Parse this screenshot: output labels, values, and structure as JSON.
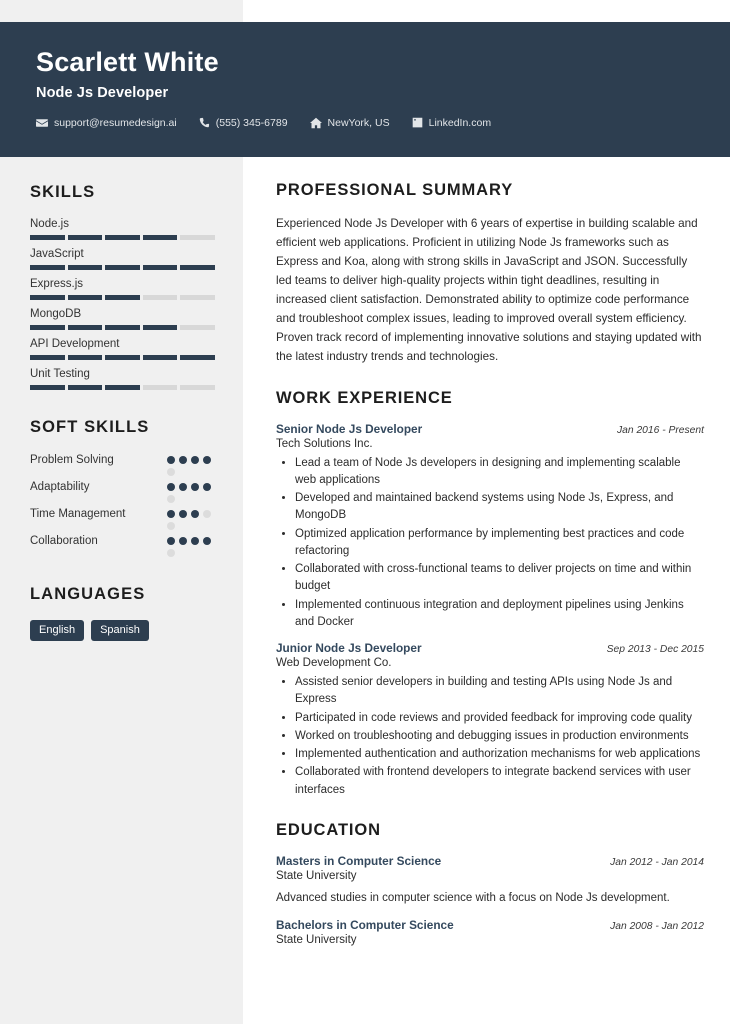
{
  "theme": {
    "dark_navy": "#2d3e50",
    "sidebar_bg": "#f0f0f0",
    "accent_title": "#34495e",
    "bar_off": "#d8d8d8",
    "dot_off": "#dcdcdc"
  },
  "header": {
    "name": "Scarlett White",
    "job_title": "Node Js Developer",
    "contacts": [
      {
        "icon": "envelope-icon",
        "text": "support@resumedesign.ai"
      },
      {
        "icon": "phone-icon",
        "text": "(555) 345-6789"
      },
      {
        "icon": "home-icon",
        "text": "NewYork, US"
      },
      {
        "icon": "linkedin-icon",
        "text": "LinkedIn.com"
      }
    ]
  },
  "sidebar": {
    "skills_heading": "SKILLS",
    "skills": [
      {
        "label": "Node.js",
        "level": 4,
        "max": 5
      },
      {
        "label": "JavaScript",
        "level": 5,
        "max": 5
      },
      {
        "label": "Express.js",
        "level": 3,
        "max": 5
      },
      {
        "label": "MongoDB",
        "level": 4,
        "max": 5
      },
      {
        "label": "API Development",
        "level": 5,
        "max": 5
      },
      {
        "label": "Unit Testing",
        "level": 3,
        "max": 5
      }
    ],
    "soft_skills_heading": "SOFT SKILLS",
    "soft_skills": [
      {
        "label": "Problem Solving",
        "level": 4,
        "max": 5
      },
      {
        "label": "Adaptability",
        "level": 4,
        "max": 5
      },
      {
        "label": "Time Management",
        "level": 3,
        "max": 5
      },
      {
        "label": "Collaboration",
        "level": 4,
        "max": 5
      }
    ],
    "languages_heading": "LANGUAGES",
    "languages": [
      "English",
      "Spanish"
    ]
  },
  "main": {
    "summary_heading": "PROFESSIONAL SUMMARY",
    "summary_text": "Experienced Node Js Developer with 6 years of expertise in building scalable and efficient web applications. Proficient in utilizing Node Js frameworks such as Express and Koa, along with strong skills in JavaScript and JSON. Successfully led teams to deliver high-quality projects within tight deadlines, resulting in increased client satisfaction. Demonstrated ability to optimize code performance and troubleshoot complex issues, leading to improved overall system efficiency. Proven track record of implementing innovative solutions and staying updated with the latest industry trends and technologies.",
    "experience_heading": "WORK EXPERIENCE",
    "experience": [
      {
        "title": "Senior Node Js Developer",
        "date": "Jan 2016 - Present",
        "org": "Tech Solutions Inc.",
        "bullets": [
          "Lead a team of Node Js developers in designing and implementing scalable web applications",
          "Developed and maintained backend systems using Node Js, Express, and MongoDB",
          "Optimized application performance by implementing best practices and code refactoring",
          "Collaborated with cross-functional teams to deliver projects on time and within budget",
          "Implemented continuous integration and deployment pipelines using Jenkins and Docker"
        ]
      },
      {
        "title": "Junior Node Js Developer",
        "date": "Sep 2013 - Dec 2015",
        "org": "Web Development Co.",
        "bullets": [
          "Assisted senior developers in building and testing APIs using Node Js and Express",
          "Participated in code reviews and provided feedback for improving code quality",
          "Worked on troubleshooting and debugging issues in production environments",
          "Implemented authentication and authorization mechanisms for web applications",
          "Collaborated with frontend developers to integrate backend services with user interfaces"
        ]
      }
    ],
    "education_heading": "EDUCATION",
    "education": [
      {
        "title": "Masters in Computer Science",
        "date": "Jan 2012 - Jan 2014",
        "org": "State University",
        "desc": "Advanced studies in computer science with a focus on Node Js development."
      },
      {
        "title": "Bachelors in Computer Science",
        "date": "Jan 2008 - Jan 2012",
        "org": "State University",
        "desc": ""
      }
    ]
  }
}
